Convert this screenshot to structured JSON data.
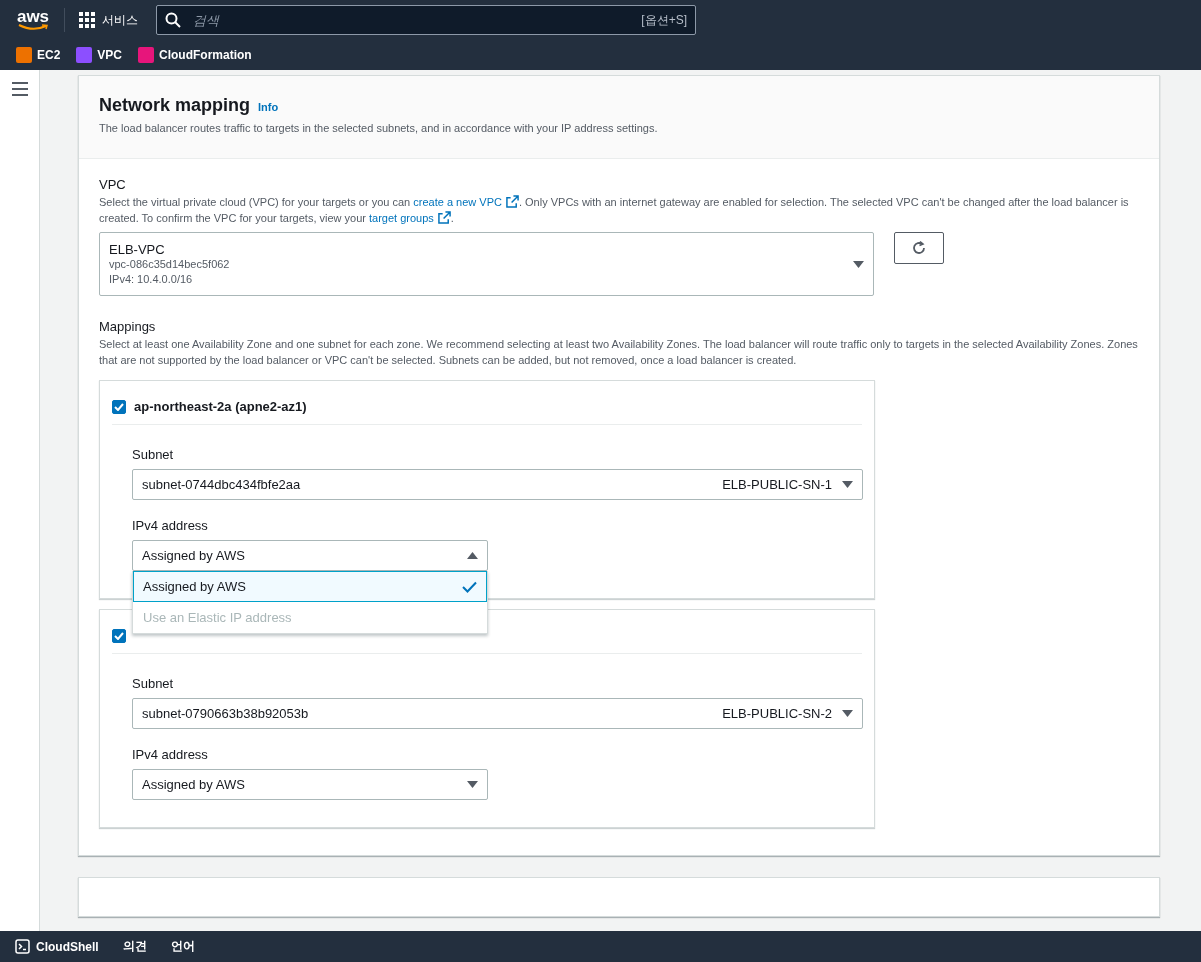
{
  "header": {
    "logo": "aws",
    "services": "서비스",
    "search": {
      "placeholder": "검색"
    },
    "shortcut": "[옵션+S]"
  },
  "favorites": [
    {
      "label": "EC2",
      "color": "#ed7100"
    },
    {
      "label": "VPC",
      "color": "#8c4fff"
    },
    {
      "label": "CloudFormation",
      "color": "#e7157b"
    }
  ],
  "section": {
    "title": "Network mapping",
    "info": "Info",
    "description": "The load balancer routes traffic to targets in the selected subnets, and in accordance with your IP address settings.",
    "vpc": {
      "label": "VPC",
      "description": [
        {
          "kind": "text",
          "text": "Select the virtual private cloud (VPC) for your targets or you can "
        },
        {
          "kind": "link",
          "text": "create a new VPC"
        },
        {
          "kind": "text",
          "text": ". Only VPCs with an internet gateway are enabled for selection. The selected VPC can't be changed after the load balancer is created. To confirm the VPC for your targets, view your "
        },
        {
          "kind": "link",
          "text": "target groups"
        },
        {
          "kind": "text",
          "text": "."
        }
      ],
      "select": {
        "name": "ELB-VPC",
        "id": "vpc-086c35d14bec5f062",
        "cidr": "IPv4: 10.4.0.0/16"
      }
    },
    "mappings": {
      "label": "Mappings",
      "description": "Select at least one Availability Zone and one subnet for each zone. We recommend selecting at least two Availability Zones. The load balancer will route traffic only to targets in the selected Availability Zones. Zones that are not supported by the load balancer or VPC can't be selected. Subnets can be added, but not removed, once a load balancer is created.",
      "zones": [
        {
          "label": "ap-northeast-2a (apne2-az1)",
          "checked": true,
          "subnet": {
            "label": "Subnet",
            "value": "subnet-0744dbc434fbfe2aa",
            "name": "ELB-PUBLIC-SN-1"
          },
          "ipv4": {
            "label": "IPv4 address",
            "value": "Assigned by AWS",
            "expanded": true,
            "options": [
              {
                "label": "Assigned by AWS",
                "selected": true,
                "disabled": false
              },
              {
                "label": "Use an Elastic IP address",
                "selected": false,
                "disabled": true
              }
            ]
          }
        },
        {
          "checked": true,
          "subnet": {
            "label": "Subnet",
            "value": "subnet-0790663b38b92053b",
            "name": "ELB-PUBLIC-SN-2"
          },
          "ipv4": {
            "label": "IPv4 address",
            "value": "Assigned by AWS",
            "expanded": false
          }
        }
      ]
    }
  },
  "footer": [
    {
      "label": "CloudShell",
      "kind": "cloudshell"
    },
    {
      "label": "의견",
      "kind": "text"
    },
    {
      "label": "언어",
      "kind": "text"
    }
  ]
}
